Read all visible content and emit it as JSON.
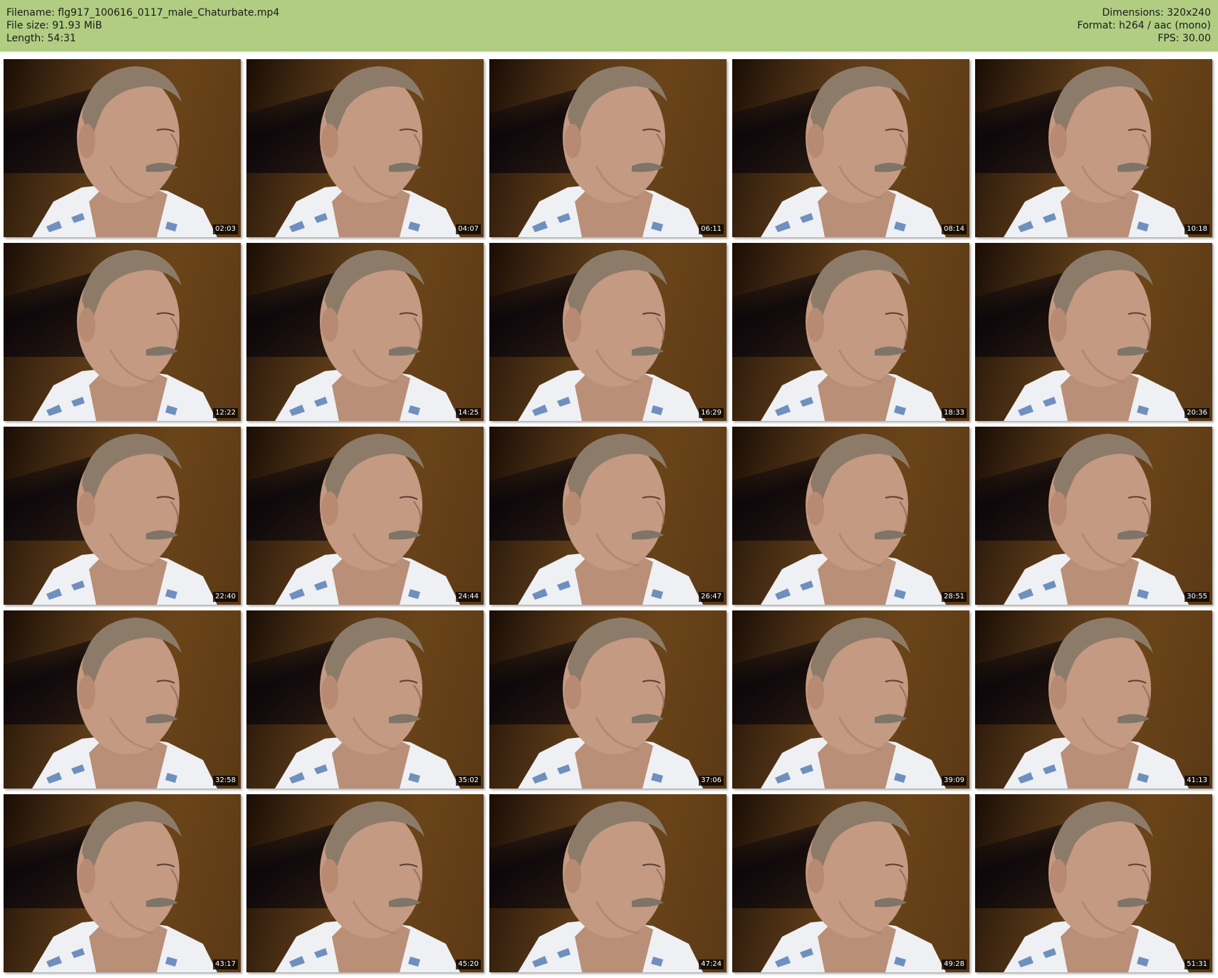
{
  "header": {
    "left": [
      "Filename: flg917_100616_0117_male_Chaturbate.mp4",
      "File size: 91.93 MiB",
      "Length: 54:31"
    ],
    "right": [
      "Dimensions: 320x240",
      "Format: h264 / aac (mono)",
      "FPS: 30.00"
    ]
  },
  "thumbnails": [
    {
      "time": "02:03"
    },
    {
      "time": "04:07"
    },
    {
      "time": "06:11"
    },
    {
      "time": "08:14"
    },
    {
      "time": "10:18"
    },
    {
      "time": "12:22"
    },
    {
      "time": "14:25"
    },
    {
      "time": "16:29"
    },
    {
      "time": "18:33"
    },
    {
      "time": "20:36"
    },
    {
      "time": "22:40"
    },
    {
      "time": "24:44"
    },
    {
      "time": "26:47"
    },
    {
      "time": "28:51"
    },
    {
      "time": "30:55"
    },
    {
      "time": "32:58"
    },
    {
      "time": "35:02"
    },
    {
      "time": "37:06"
    },
    {
      "time": "39:09"
    },
    {
      "time": "41:13"
    },
    {
      "time": "43:17"
    },
    {
      "time": "45:20"
    },
    {
      "time": "47:24"
    },
    {
      "time": "49:28"
    },
    {
      "time": "51:31"
    }
  ],
  "colors": {
    "header_bg": "#b0cd82",
    "timestamp_bg": "#000000",
    "timestamp_text": "#ffffff"
  }
}
